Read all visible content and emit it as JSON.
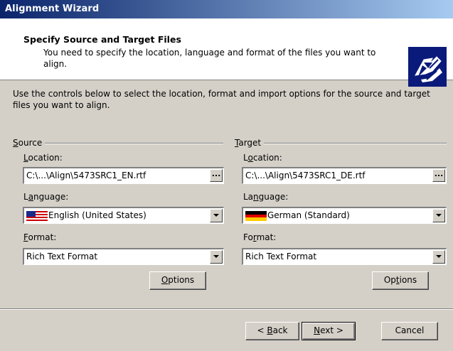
{
  "window": {
    "title": "Alignment Wizard"
  },
  "header": {
    "title": "Specify Source and Target Files",
    "subtitle": "You need to specify the location, language and format of the files you want to align.",
    "logo_icon": "wizard-hands-icon"
  },
  "intro": "Use the controls below to select the location, format and import options for the source and target files you want to align.",
  "source": {
    "group_label": "Source",
    "location_label": "Location:",
    "location_value": "C:\\...\\Align\\5473SRC1_EN.rtf",
    "browse_label": "...",
    "language_label": "Language:",
    "language_value": "English (United States)",
    "language_flag": "us-flag-icon",
    "format_label": "Format:",
    "format_value": "Rich Text Format",
    "options_label": "Options"
  },
  "target": {
    "group_label": "Target",
    "location_label": "Location:",
    "location_value": "C:\\...\\Align\\5473SRC1_DE.rtf",
    "browse_label": "...",
    "language_label": "Language:",
    "language_value": "German (Standard)",
    "language_flag": "german-flag-icon",
    "format_label": "Format:",
    "format_value": "Rich Text Format",
    "options_label": "Options"
  },
  "buttons": {
    "back": "< Back",
    "next": "Next >",
    "cancel": "Cancel"
  }
}
